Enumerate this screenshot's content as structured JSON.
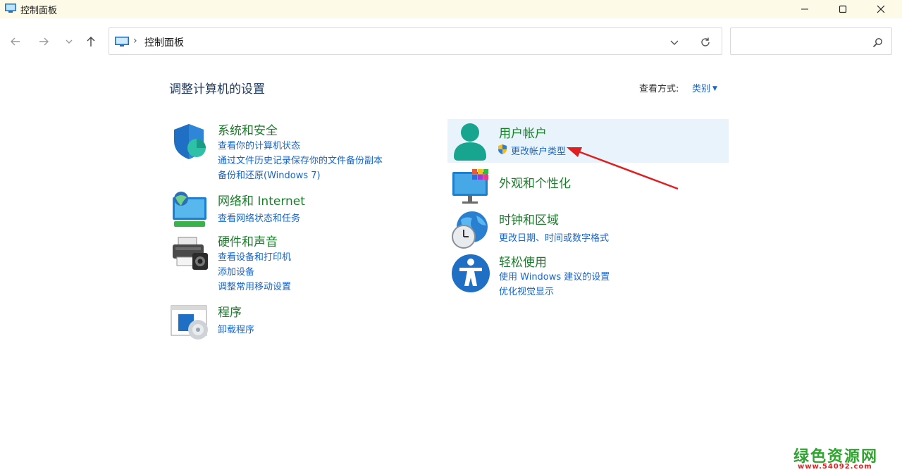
{
  "window": {
    "title": "控制面板"
  },
  "address": {
    "breadcrumb": "控制面板",
    "search_placeholder": ""
  },
  "header": {
    "title": "调整计算机的设置",
    "view_label": "查看方式:",
    "view_value": "类别"
  },
  "categories_left": [
    {
      "title": "系统和安全",
      "links": [
        "查看你的计算机状态",
        "通过文件历史记录保存你的文件备份副本",
        "备份和还原(Windows 7)"
      ]
    },
    {
      "title": "网络和 Internet",
      "links": [
        "查看网络状态和任务"
      ]
    },
    {
      "title": "硬件和声音",
      "links": [
        "查看设备和打印机",
        "添加设备",
        "调整常用移动设置"
      ]
    },
    {
      "title": "程序",
      "links": [
        "卸载程序"
      ]
    }
  ],
  "categories_right": [
    {
      "title": "用户帐户",
      "links": [
        "更改帐户类型"
      ]
    },
    {
      "title": "外观和个性化",
      "links": []
    },
    {
      "title": "时钟和区域",
      "links": [
        "更改日期、时间或数字格式"
      ]
    },
    {
      "title": "轻松使用",
      "links": [
        "使用 Windows 建议的设置",
        "优化视觉显示"
      ]
    }
  ],
  "watermark": {
    "text": "绿色资源网",
    "url": "www.54092.com"
  },
  "colors": {
    "category_title": "#1a7d2a",
    "link": "#1a66c7",
    "highlight": "#e8f3fc",
    "annotation_arrow": "#e02020"
  }
}
